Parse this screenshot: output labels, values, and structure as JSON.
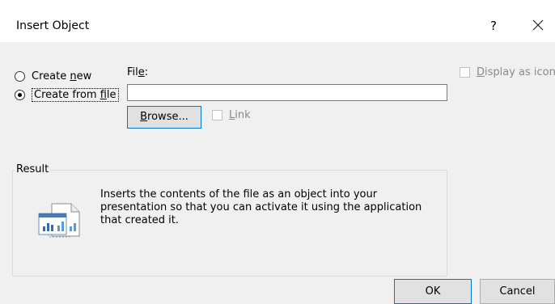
{
  "window": {
    "title": "Insert Object",
    "help_label": "?"
  },
  "options": {
    "create_new": {
      "prefix": "Create ",
      "accel": "n",
      "suffix": "ew"
    },
    "create_from_file": {
      "prefix": "Create from ",
      "accel": "f",
      "suffix": "ile"
    }
  },
  "file": {
    "label_prefix": "Fil",
    "label_accel": "e",
    "label_suffix": ":",
    "value": ""
  },
  "browse_button": {
    "accel": "B",
    "suffix": "rowse..."
  },
  "link_checkbox": {
    "accel": "L",
    "suffix": "ink"
  },
  "display_as_icon": {
    "accel": "D",
    "suffix": "isplay as icon"
  },
  "result": {
    "label": "Result",
    "text": "Inserts the contents of the file as an object into your presentation so that you can activate it using the application that created it."
  },
  "footer": {
    "ok_label": "OK",
    "cancel_label": "Cancel"
  },
  "colors": {
    "accent": "#0078d7",
    "dialog_bg": "#f0f0f0",
    "disabled_text": "#8a8a8a"
  }
}
